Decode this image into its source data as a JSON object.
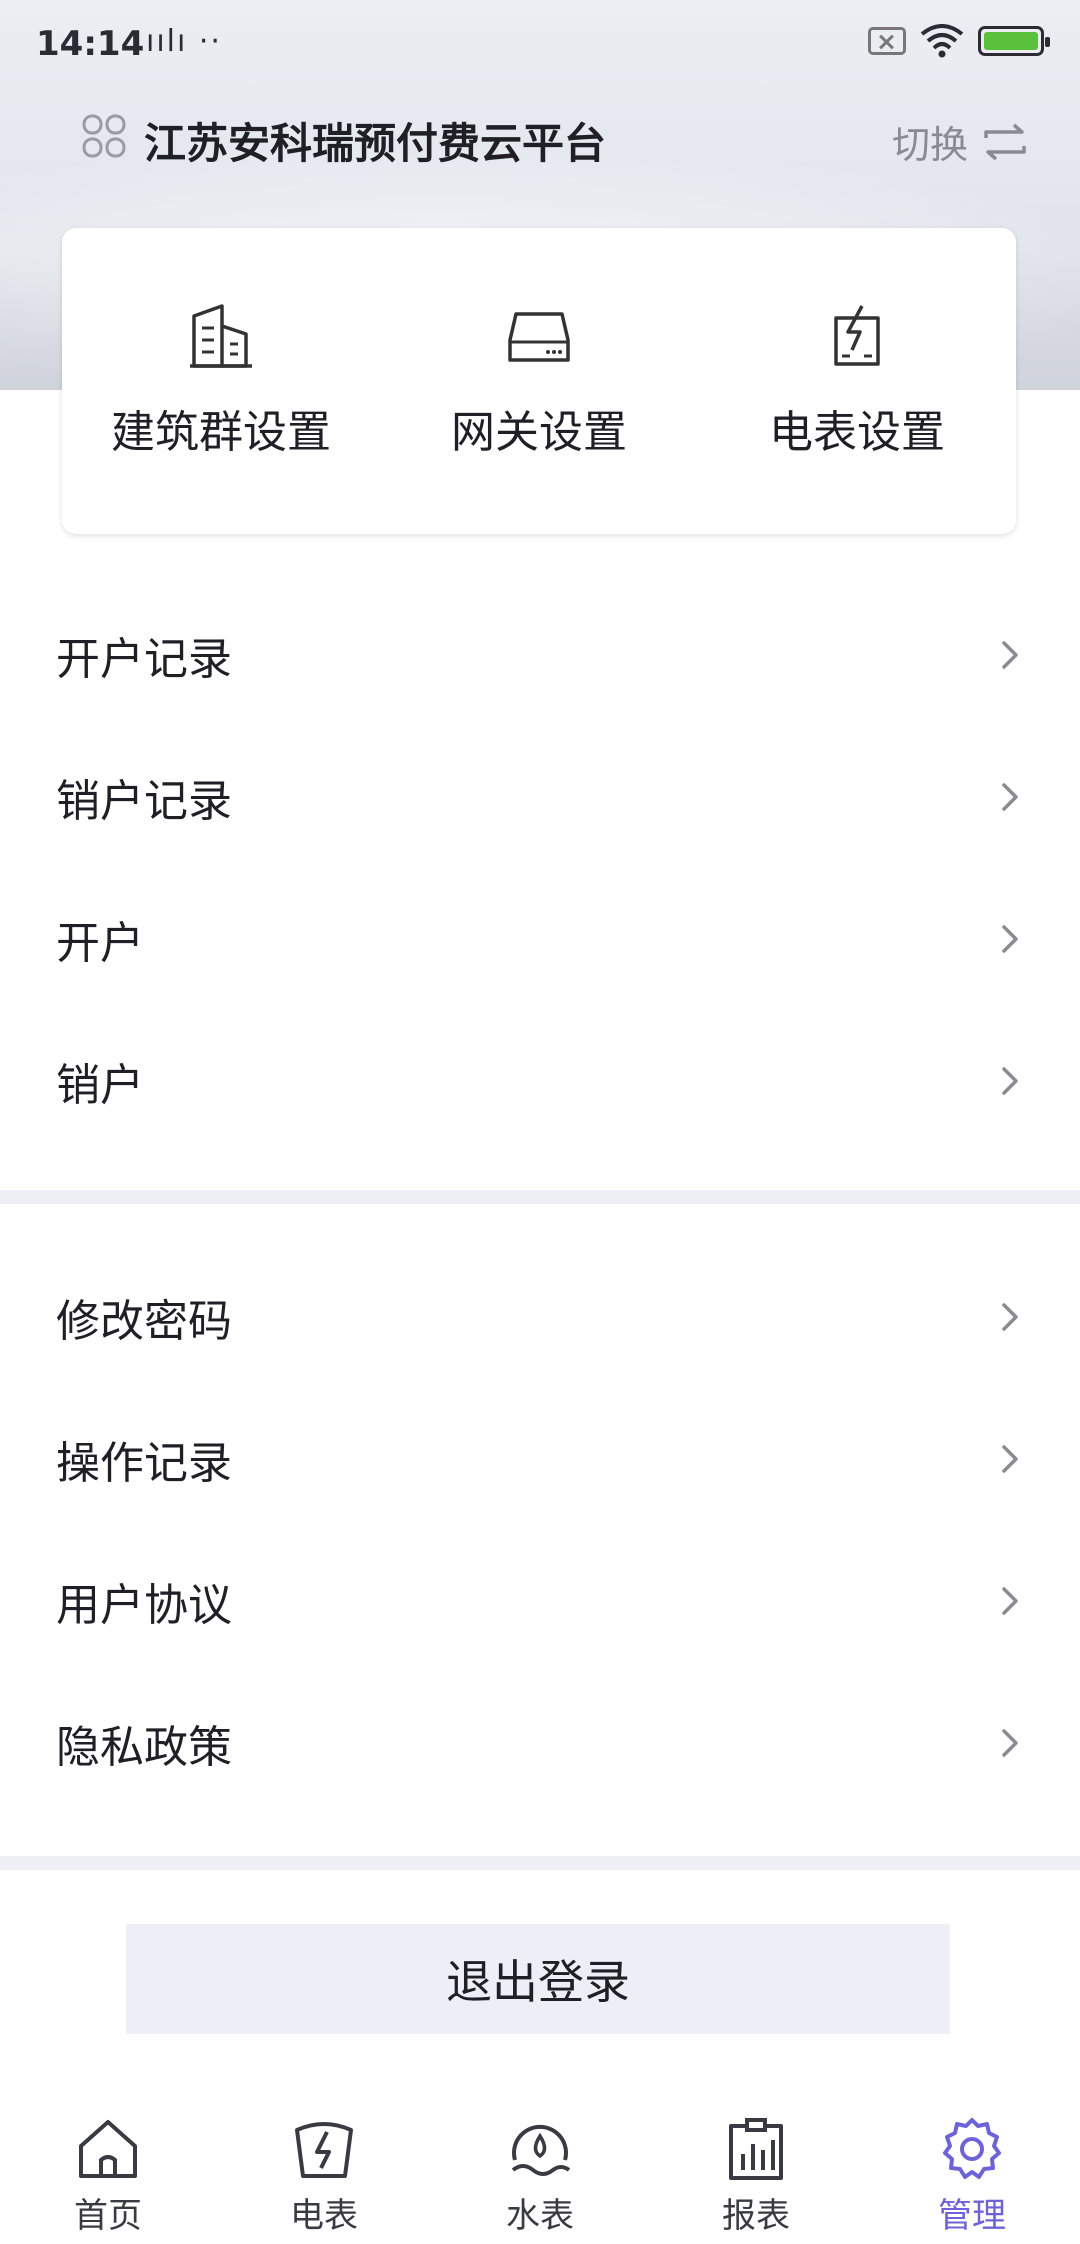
{
  "status_bar": {
    "time": "14:14",
    "left_icons": "ıılı ··"
  },
  "header": {
    "title": "江苏安科瑞预付费云平台",
    "switch_label": "切换"
  },
  "quick_actions": [
    {
      "label": "建筑群设置",
      "icon": "buildings-icon"
    },
    {
      "label": "网关设置",
      "icon": "gateway-icon"
    },
    {
      "label": "电表设置",
      "icon": "meter-settings-icon"
    }
  ],
  "menu_group1": [
    {
      "label": "开户记录"
    },
    {
      "label": "销户记录"
    },
    {
      "label": "开户"
    },
    {
      "label": "销户"
    }
  ],
  "menu_group2": [
    {
      "label": "修改密码"
    },
    {
      "label": "操作记录"
    },
    {
      "label": "用户协议"
    },
    {
      "label": "隐私政策"
    }
  ],
  "logout_label": "退出登录",
  "tabbar": [
    {
      "label": "首页",
      "icon": "home-icon"
    },
    {
      "label": "电表",
      "icon": "electric-meter-icon"
    },
    {
      "label": "水表",
      "icon": "water-meter-icon"
    },
    {
      "label": "报表",
      "icon": "report-icon"
    },
    {
      "label": "管理",
      "icon": "gear-icon",
      "active": true
    }
  ],
  "colors": {
    "accent": "#6e63d6",
    "divider": "#eeeef5",
    "logout_bg": "#eeeef6"
  }
}
